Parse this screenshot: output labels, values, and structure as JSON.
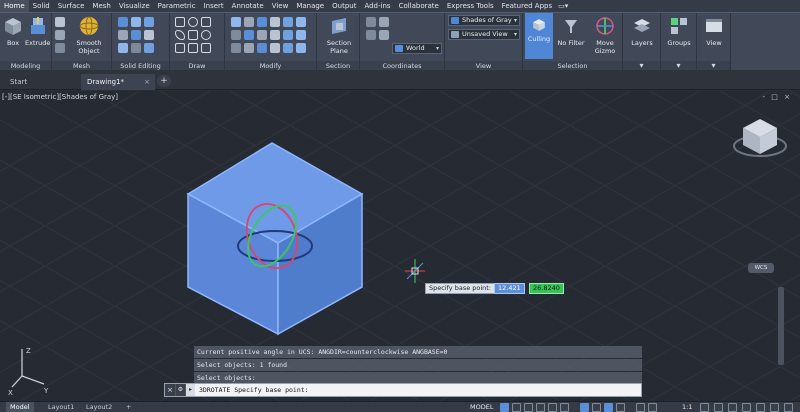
{
  "ribbon_tabs": [
    "Home",
    "Solid",
    "Surface",
    "Mesh",
    "Visualize",
    "Parametric",
    "Insert",
    "Annotate",
    "View",
    "Manage",
    "Output",
    "Add-ins",
    "Collaborate",
    "Express Tools",
    "Featured Apps"
  ],
  "active_tab": "Home",
  "ribbon": {
    "box_label": "Box",
    "extrude_label": "Extrude",
    "smooth_object_label": "Smooth Object",
    "section_plane_label": "Section Plane",
    "culling_label": "Culling",
    "no_filter_label": "No Filter",
    "move_gizmo_label": "Move Gizmo",
    "layers_label": "Layers",
    "groups_label": "Groups",
    "view_label": "View",
    "visual_style": "Shades of Gray",
    "named_view": "Unsaved View",
    "ucs_name": "World",
    "groups": {
      "modeling": "Modeling",
      "mesh": "Mesh",
      "solid_editing": "Solid Editing",
      "draw": "Draw",
      "modify": "Modify",
      "section": "Section",
      "coordinates": "Coordinates",
      "view": "View",
      "selection": "Selection"
    }
  },
  "file_tabs": {
    "start": "Start",
    "drawing": "Drawing1*",
    "new_tab": "+"
  },
  "viewport": {
    "label": "[-][SE Isometric][Shades of Gray]",
    "window_controls": "- □ ×",
    "wcs_label": "WCS",
    "tooltip": "Specify base point:",
    "dyn_x": "12.421",
    "dyn_y": "26.8240"
  },
  "history": [
    "Current positive angle in UCS:  ANGDIR=counterclockwise  ANGBASE=0",
    "Select objects: 1 found",
    "Select objects:"
  ],
  "command_line": {
    "text": "3DROTATE Specify base point:"
  },
  "layout_tabs": [
    "Model",
    "Layout1",
    "Layout2"
  ],
  "status": {
    "model": "MODEL",
    "scale": "1:1"
  }
}
